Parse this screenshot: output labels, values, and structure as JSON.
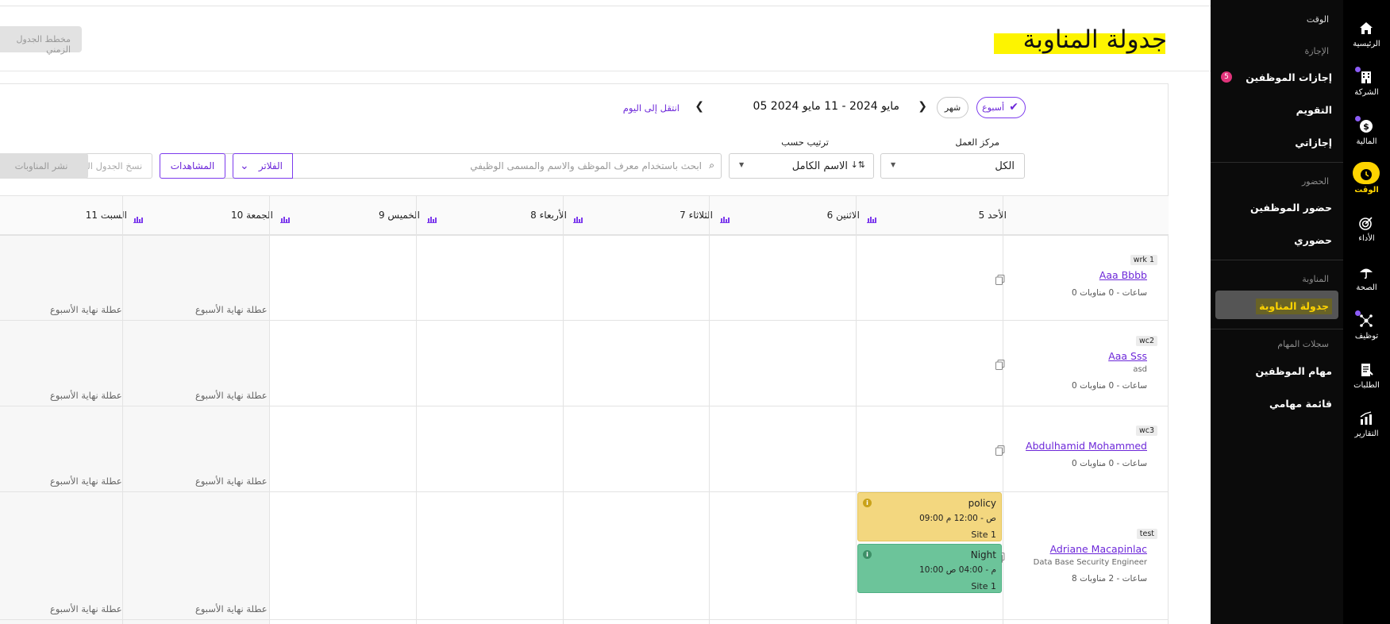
{
  "rail": [
    {
      "label": "الرئيسية",
      "icon": "home-icon",
      "dot": false
    },
    {
      "label": "الشركة",
      "icon": "building-icon",
      "dot": true
    },
    {
      "label": "المالية",
      "icon": "dollar-icon",
      "dot": true
    },
    {
      "label": "الوقت",
      "icon": "clock-icon",
      "dot": false,
      "active": true
    },
    {
      "label": "الأداء",
      "icon": "target-icon",
      "dot": false
    },
    {
      "label": "الصحة",
      "icon": "umbrella-icon",
      "dot": false
    },
    {
      "label": "توظيف",
      "icon": "network-icon",
      "dot": true
    },
    {
      "label": "الطلبات",
      "icon": "document-icon",
      "dot": false
    },
    {
      "label": "التقارير",
      "icon": "chart-icon",
      "dot": false
    }
  ],
  "sidebar": {
    "header": "الوقت",
    "sections": {
      "leave": "الإجازة",
      "attendance": "الحضور",
      "shifts": "المناوبة",
      "tasks": "سجلات المهام"
    },
    "links": {
      "employee_leaves": "إجازات الموظفين",
      "employee_leaves_badge": "5",
      "calendar": "التقويم",
      "my_leaves": "إجازاتي",
      "employee_attendance": "حضور الموظفين",
      "my_attendance": "حضوري",
      "shift_schedule": "جدولة المناوبة",
      "employee_tasks": "مهام الموظفين",
      "my_tasks": "قائمة مهامي"
    }
  },
  "header": {
    "title": "جدولة المناوبة",
    "plan_button": "مخطط الجدول الزمني"
  },
  "toolbar": {
    "week": "أسبوع",
    "month": "شهر",
    "range": "05 مايو 2024 - 11 مايو 2024",
    "today": "انتقل إلى اليوم",
    "work_center_label": "مركز العمل",
    "work_center_value": "الكل",
    "sort_label": "ترتيب حسب",
    "sort_value": "الاسم الكامل",
    "search_placeholder": "ابحث باستخدام معرف الموظف والاسم والمسمى الوظيفي",
    "filters": "الفلاتر",
    "views": "المشاهدات",
    "copy_schedule": "نسخ الجدول الزمني",
    "publish": "نشر المناوبات"
  },
  "days": [
    "الأحد 5",
    "الاثنين 6",
    "الثلاثاء 7",
    "الأربعاء 8",
    "الخميس 9",
    "الجمعة 10",
    "السبت 11"
  ],
  "weekend_label": "عطلة نهاية الأسبوع",
  "employees": [
    {
      "tag": "wrk 1",
      "name": "Aaa Bbbb",
      "subtitle": "",
      "hours": "0 ساعات - 0 مناوبات"
    },
    {
      "tag": "wc2",
      "name": "Aaa Sss",
      "subtitle": "asd",
      "hours": "0 ساعات - 0 مناوبات"
    },
    {
      "tag": "wc3",
      "name": "Abdulhamid Mohammed",
      "subtitle": "",
      "hours": "0 ساعات - 0 مناوبات"
    },
    {
      "tag": "test",
      "name": "Adriane Macapinlac",
      "subtitle": "Data Base Security Engineer",
      "hours": "8 ساعات - 2 مناوبات"
    }
  ],
  "shifts": [
    {
      "name": "policy",
      "time": "09:00 ص - 12:00 م",
      "site": "Site 1",
      "color": "#f3d77f",
      "info_color": "#c9a21a"
    },
    {
      "name": "Night",
      "time": "10:00 م - 04:00 ص",
      "site": "Site 1",
      "color": "#6cc49a",
      "info_color": "#3d8f67"
    }
  ],
  "colors": {
    "accent": "#6d28d9",
    "highlight": "#fdf400",
    "sidebar_bg": "#0b0b0b"
  }
}
